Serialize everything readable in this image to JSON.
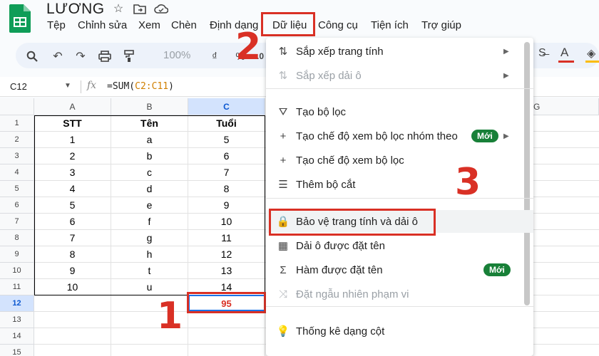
{
  "doc": {
    "title": "LƯƠNG"
  },
  "menu": [
    {
      "label": "Tệp",
      "key": "file"
    },
    {
      "label": "Chỉnh sửa",
      "key": "edit"
    },
    {
      "label": "Xem",
      "key": "view"
    },
    {
      "label": "Chèn",
      "key": "insert"
    },
    {
      "label": "Định dạng",
      "key": "format"
    },
    {
      "label": "Dữ liệu",
      "key": "data"
    },
    {
      "label": "Công cụ",
      "key": "tools"
    },
    {
      "label": "Tiện ích",
      "key": "extensions"
    },
    {
      "label": "Trợ giúp",
      "key": "help"
    }
  ],
  "toolbar": {
    "zoom": "100%",
    "currency": "₫",
    "percent": "%",
    "decimal": ".0"
  },
  "formula_bar": {
    "cell_ref": "C12",
    "fx": "fx",
    "formula_prefix": "=SUM(",
    "formula_ref": "C2:C11",
    "formula_suffix": ")"
  },
  "sheet": {
    "columns": [
      "A",
      "B",
      "C",
      "G"
    ],
    "row_numbers": [
      "1",
      "2",
      "3",
      "4",
      "5",
      "6",
      "7",
      "8",
      "9",
      "10",
      "11",
      "12",
      "13",
      "14",
      "15"
    ],
    "header": [
      "STT",
      "Tên",
      "Tuổi"
    ],
    "rows": [
      [
        "1",
        "a",
        "5"
      ],
      [
        "2",
        "b",
        "6"
      ],
      [
        "3",
        "c",
        "7"
      ],
      [
        "4",
        "d",
        "8"
      ],
      [
        "5",
        "e",
        "9"
      ],
      [
        "6",
        "f",
        "10"
      ],
      [
        "7",
        "g",
        "11"
      ],
      [
        "8",
        "h",
        "12"
      ],
      [
        "9",
        "t",
        "13"
      ],
      [
        "10",
        "u",
        "14"
      ]
    ],
    "total": "95"
  },
  "dropdown": {
    "items": [
      {
        "label": "Sắp xếp trang tính",
        "icon": "sort-icon",
        "glyph": "⇅",
        "submenu": true,
        "disabled": false
      },
      {
        "label": "Sắp xếp dải ô",
        "icon": "sort-range-icon",
        "glyph": "⇅",
        "submenu": true,
        "disabled": true
      },
      {
        "label": "Tạo bộ lọc",
        "icon": "filter-icon",
        "glyph": "⛛",
        "submenu": false,
        "disabled": false
      },
      {
        "label": "Tạo chế độ xem bộ lọc nhóm theo",
        "icon": "plus-icon",
        "glyph": "+",
        "submenu": true,
        "disabled": false,
        "badge": "Mới"
      },
      {
        "label": "Tạo chế độ xem bộ lọc",
        "icon": "plus-icon",
        "glyph": "+",
        "submenu": false,
        "disabled": false
      },
      {
        "label": "Thêm bộ cắt",
        "icon": "slicer-icon",
        "glyph": "☰",
        "submenu": false,
        "disabled": false
      },
      {
        "label": "Bảo vệ trang tính và dải ô",
        "icon": "lock-icon",
        "glyph": "🔒",
        "submenu": false,
        "disabled": false
      },
      {
        "label": "Dải ô được đặt tên",
        "icon": "table-icon",
        "glyph": "▦",
        "submenu": false,
        "disabled": false
      },
      {
        "label": "Hàm được đặt tên",
        "icon": "sigma-icon",
        "glyph": "Σ",
        "submenu": false,
        "disabled": false,
        "badge": "Mới"
      },
      {
        "label": "Đặt ngẫu nhiên phạm vi",
        "icon": "shuffle-icon",
        "glyph": "⤨",
        "submenu": false,
        "disabled": true
      },
      {
        "label": "Thống kê dạng cột",
        "icon": "bulb-icon",
        "glyph": "💡",
        "submenu": false,
        "disabled": false
      }
    ]
  },
  "steps": {
    "one": "1",
    "two": "2",
    "three": "3"
  },
  "colors": {
    "accent": "#d93025",
    "selection": "#1a73e8",
    "badge": "#188038"
  }
}
